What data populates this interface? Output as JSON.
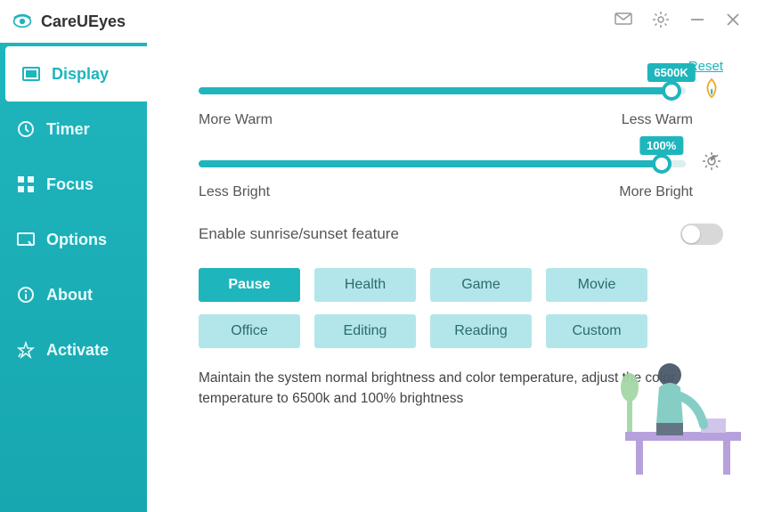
{
  "app": {
    "title": "CareUEyes"
  },
  "sidebar": {
    "items": [
      {
        "label": "Display"
      },
      {
        "label": "Timer"
      },
      {
        "label": "Focus"
      },
      {
        "label": "Options"
      },
      {
        "label": "About"
      },
      {
        "label": "Activate"
      }
    ]
  },
  "display": {
    "reset": "Reset",
    "temperature": {
      "value": "6500K",
      "percent": 97,
      "label_left": "More Warm",
      "label_right": "Less Warm"
    },
    "brightness": {
      "value": "100%",
      "percent": 95,
      "label_left": "Less Bright",
      "label_right": "More Bright"
    },
    "sunrise_label": "Enable sunrise/sunset feature",
    "sunrise_enabled": false,
    "modes": [
      {
        "label": "Pause",
        "active": true
      },
      {
        "label": "Health"
      },
      {
        "label": "Game"
      },
      {
        "label": "Movie"
      },
      {
        "label": "Office"
      },
      {
        "label": "Editing"
      },
      {
        "label": "Reading"
      },
      {
        "label": "Custom"
      }
    ],
    "description": "Maintain the system normal brightness and color temperature, adjust the color temperature to 6500k and 100% brightness"
  }
}
